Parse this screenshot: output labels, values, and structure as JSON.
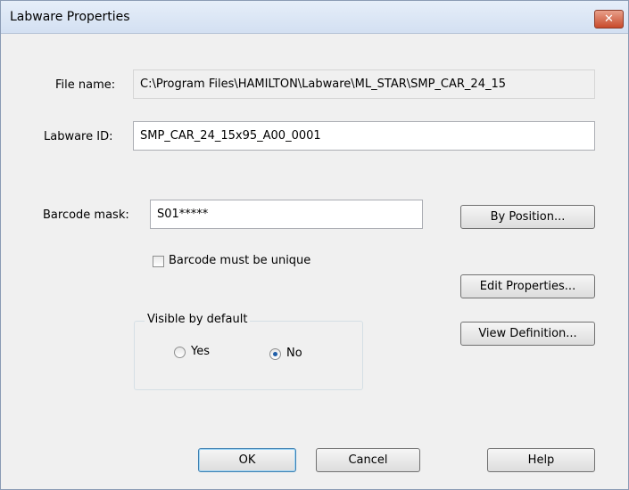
{
  "window": {
    "title": "Labware Properties",
    "close_label": "✕"
  },
  "file": {
    "label": "File name:",
    "value": "C:\\Program Files\\HAMILTON\\Labware\\ML_STAR\\SMP_CAR_24_15"
  },
  "labware": {
    "label": "Labware ID:",
    "value": "SMP_CAR_24_15x95_A00_0001"
  },
  "barcode": {
    "label": "Barcode mask:",
    "value": "S01*****",
    "by_position_label": "By Position...",
    "unique_label": "Barcode must be unique",
    "unique_checked": false
  },
  "buttons": {
    "edit_properties": "Edit Properties...",
    "view_definition": "View Definition...",
    "ok": "OK",
    "cancel": "Cancel",
    "help": "Help"
  },
  "visible": {
    "legend": "Visible by default",
    "yes_label": "Yes",
    "no_label": "No",
    "selected": "No"
  }
}
